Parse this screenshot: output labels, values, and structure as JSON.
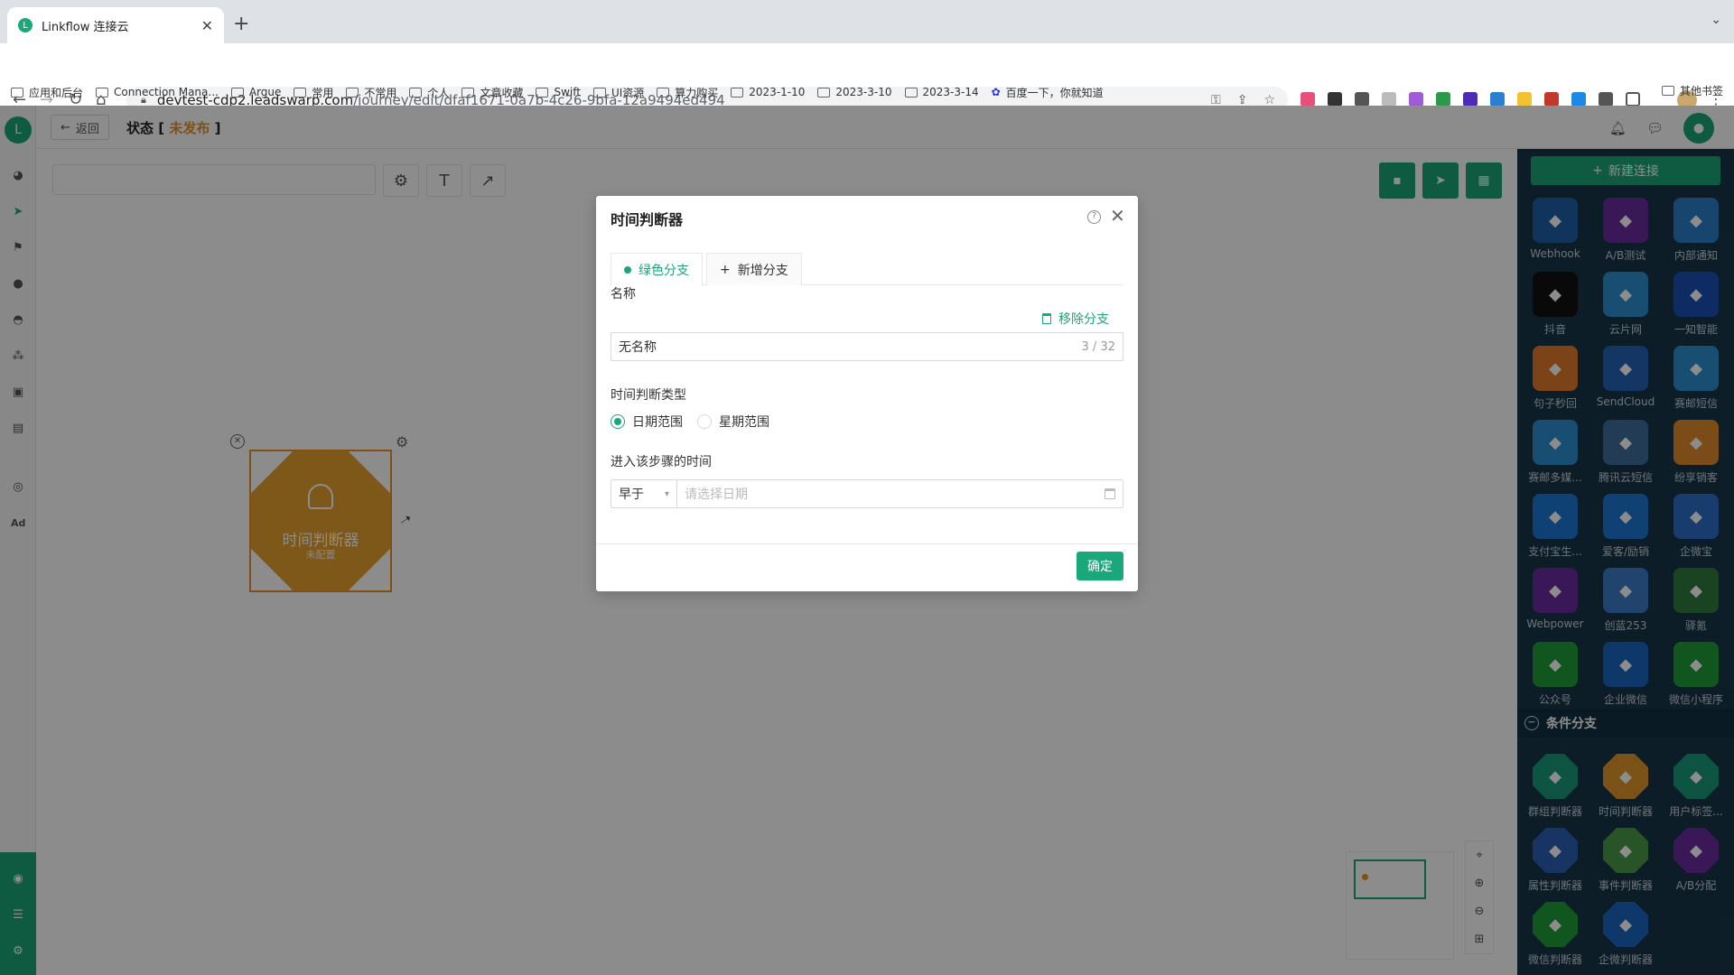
{
  "browser": {
    "tab_title": "Linkflow 连接云",
    "url_host": "devtest-cdp2.leadswarp.com",
    "url_path": "/journey/edit/dfaf1671-0a7b-4c26-9bfa-12a9494ed494",
    "bookmarks": [
      "应用和后台",
      "Connection Mana...",
      "Argue",
      "常用",
      "不常用",
      "个人",
      "文章收藏",
      "Swift",
      "UI资源",
      "算力购买",
      "2023-1-10",
      "2023-3-10",
      "2023-3-14",
      "百度一下，你就知道"
    ],
    "other_bookmarks": "其他书签"
  },
  "topbar": {
    "back_label": "返回",
    "status_label": "状态 [",
    "status_value": "未发布",
    "status_close": "]"
  },
  "node": {
    "title": "时间判断器",
    "subtitle": "未配置"
  },
  "right_panel": {
    "new_connection": "新建连接",
    "connectors": [
      {
        "label": "Webhook",
        "color": "#1f5fa8"
      },
      {
        "label": "A/B测试",
        "color": "#6b2da0"
      },
      {
        "label": "内部通知",
        "color": "#2a7fc7"
      },
      {
        "label": "抖音",
        "color": "#111111"
      },
      {
        "label": "云片网",
        "color": "#2a8fd0"
      },
      {
        "label": "一知智能",
        "color": "#1b4fb5"
      },
      {
        "label": "句子秒回",
        "color": "#e07b2a"
      },
      {
        "label": "SendCloud",
        "color": "#2363b8"
      },
      {
        "label": "赛邮短信",
        "color": "#2a8fd0"
      },
      {
        "label": "赛邮多媒...",
        "color": "#2a8fd0"
      },
      {
        "label": "腾讯云短信",
        "color": "#3d6e99"
      },
      {
        "label": "纷享销客",
        "color": "#e08a2a"
      },
      {
        "label": "支付宝生...",
        "color": "#1e77d6"
      },
      {
        "label": "爱客/励销",
        "color": "#1e77d6"
      },
      {
        "label": "企微宝",
        "color": "#2a6ec7"
      },
      {
        "label": "Webpower",
        "color": "#6b2da0"
      },
      {
        "label": "创蓝253",
        "color": "#3d7ccb"
      },
      {
        "label": "驿氪",
        "color": "#2f7a3c"
      },
      {
        "label": "公众号",
        "color": "#1f9c3a"
      },
      {
        "label": "企业微信",
        "color": "#1a66c2"
      },
      {
        "label": "微信小程序",
        "color": "#1f9c3a"
      }
    ],
    "condition_section": "条件分支",
    "conditions": [
      {
        "label": "群组判断器",
        "color": "#1a9a78"
      },
      {
        "label": "时间判断器",
        "color": "#e0952b"
      },
      {
        "label": "用户标签...",
        "color": "#1a9a78"
      },
      {
        "label": "属性判断器",
        "color": "#2a5fb5"
      },
      {
        "label": "事件判断器",
        "color": "#4a9a4a"
      },
      {
        "label": "A/B分配",
        "color": "#6b2da0"
      },
      {
        "label": "微信判断器",
        "color": "#1f9c3a"
      },
      {
        "label": "企微判断器",
        "color": "#1a66c2"
      }
    ]
  },
  "modal": {
    "title": "时间判断器",
    "tabs": [
      "绿色分支",
      "新增分支"
    ],
    "name_label": "名称",
    "remove_branch": "移除分支",
    "name_value": "无名称",
    "name_count": "3 / 32",
    "type_label": "时间判断类型",
    "type_options": [
      "日期范围",
      "星期范围"
    ],
    "type_selected": "日期范围",
    "enter_time_label": "进入该步骤的时间",
    "before_select": "早于",
    "date_placeholder": "请选择日期",
    "ok_button": "确定"
  }
}
